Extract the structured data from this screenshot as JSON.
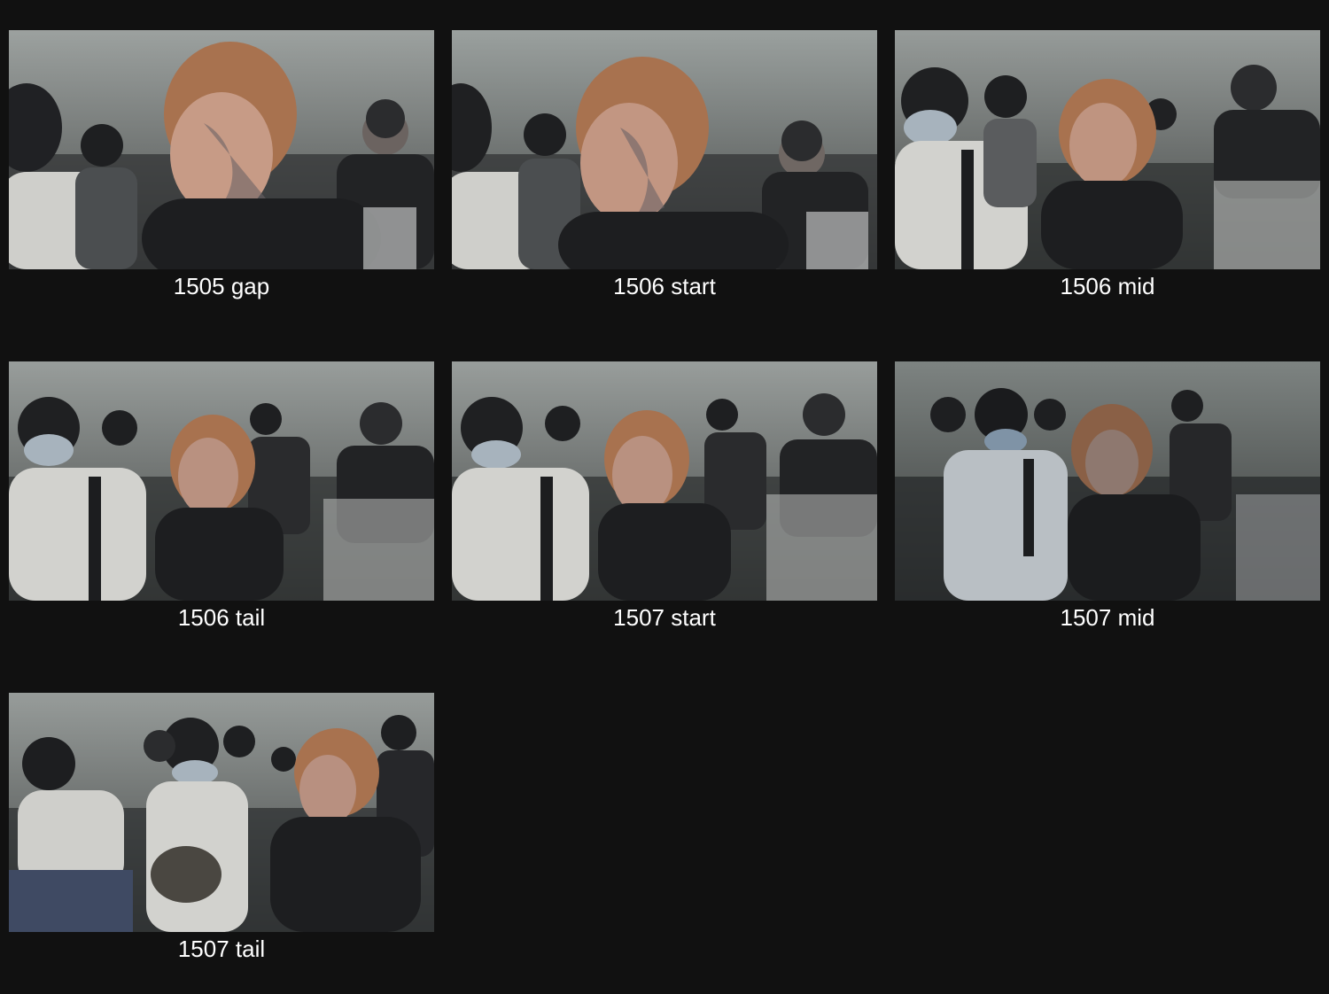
{
  "frames": [
    {
      "label": "1505 gap"
    },
    {
      "label": "1506 start"
    },
    {
      "label": "1506 mid"
    },
    {
      "label": "1506 tail"
    },
    {
      "label": "1507 start"
    },
    {
      "label": "1507 mid"
    },
    {
      "label": "1507 tail"
    }
  ],
  "colors": {
    "background": "#111111",
    "caption_text": "#ffffff",
    "backdrop": "#8e9391",
    "hair_orange": "#a8724f",
    "dark_shirt": "#1d1e20",
    "white_shirt": "#d4d4d0"
  }
}
